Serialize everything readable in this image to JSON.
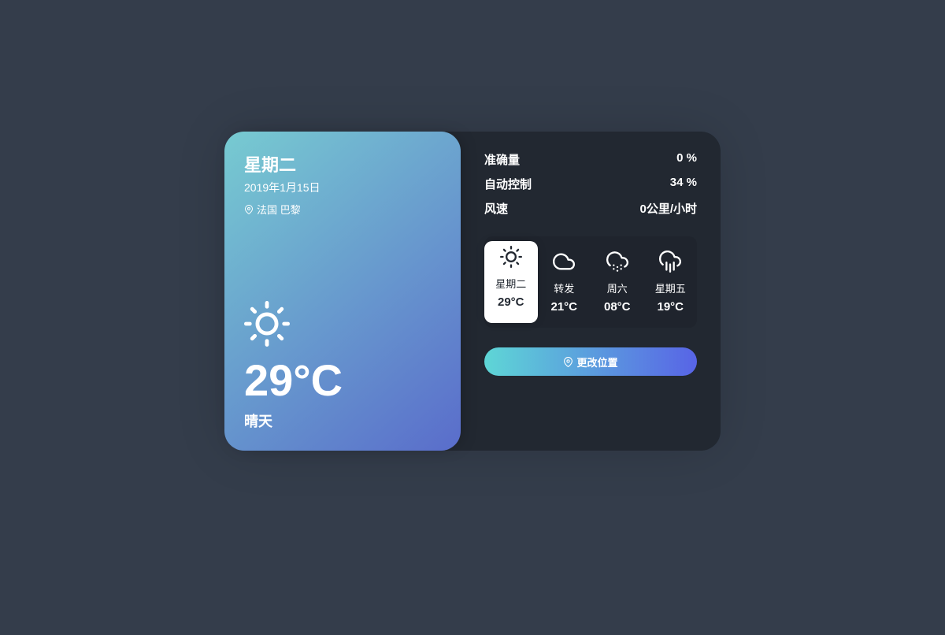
{
  "current": {
    "day": "星期二",
    "date": "2019年1月15日",
    "location": "法国 巴黎",
    "temp": "29°C",
    "condition": "晴天"
  },
  "stats": {
    "precipitation_label": "准确量",
    "precipitation_value": "0 %",
    "humidity_label": "自动控制",
    "humidity_value": "34 %",
    "wind_label": "风速",
    "wind_value": "0公里/小时"
  },
  "forecast": [
    {
      "day": "星期二",
      "temp": "29°C"
    },
    {
      "day": "转发",
      "temp": "21°C"
    },
    {
      "day": "周六",
      "temp": "08°C"
    },
    {
      "day": "星期五",
      "temp": "19°C"
    }
  ],
  "button": {
    "label": "更改位置"
  }
}
